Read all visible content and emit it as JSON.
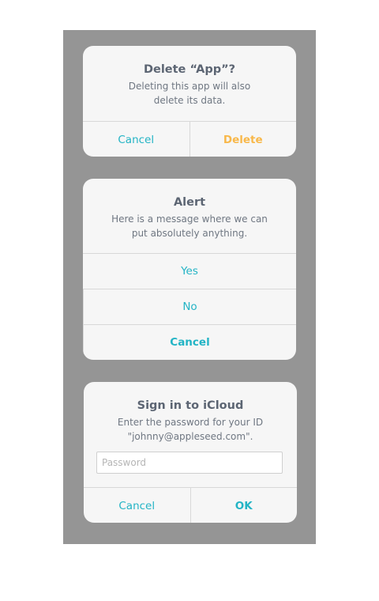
{
  "delete_alert": {
    "title": "Delete “App”?",
    "message": "Deleting this app will also delete its data.",
    "cancel_label": "Cancel",
    "delete_label": "Delete"
  },
  "generic_alert": {
    "title": "Alert",
    "message": "Here is a message where we can put absolutely anything.",
    "buttons": [
      "Yes",
      "No",
      "Cancel"
    ]
  },
  "signin_alert": {
    "title": "Sign in to iCloud",
    "message": "Enter the password for your ID \"johnny@appleseed.com\".",
    "password_value": "",
    "password_placeholder": "Password",
    "cancel_label": "Cancel",
    "ok_label": "OK"
  },
  "colors": {
    "accent": "#23b4c5",
    "destructive": "#f8b84a",
    "backdrop": "#959595",
    "alert_background": "#f6f6f6"
  }
}
